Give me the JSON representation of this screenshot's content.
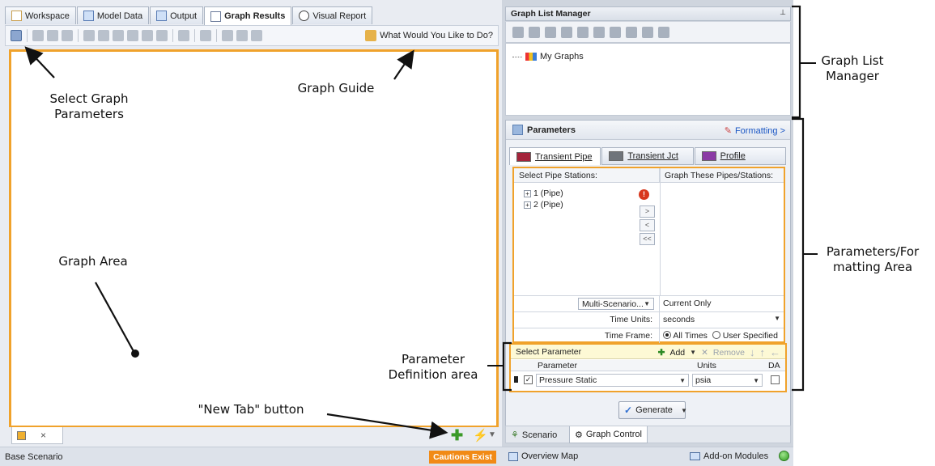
{
  "tabs": [
    {
      "label": "Workspace",
      "icon": "pencil-icon"
    },
    {
      "label": "Model Data",
      "icon": "table-icon"
    },
    {
      "label": "Output",
      "icon": "grid-icon"
    },
    {
      "label": "Graph Results",
      "icon": "graph-icon",
      "active": true
    },
    {
      "label": "Visual Report",
      "icon": "eye-icon"
    }
  ],
  "toolbar": {
    "what_would_you_like": "What Would You Like to Do?"
  },
  "bottom": {
    "close_glyph": "×"
  },
  "status_left": {
    "scenario": "Base Scenario",
    "cautions": "Cautions Exist"
  },
  "graph_list_manager": {
    "title": "Graph List Manager",
    "pin": "⊥",
    "root_item": "My Graphs"
  },
  "parameters": {
    "title": "Parameters",
    "formatting_link": "Formatting >",
    "tabs": [
      "Transient Pipe",
      "Transient Jct",
      "Profile"
    ],
    "select_pipe_stations": "Select Pipe Stations:",
    "graph_these": "Graph These Pipes/Stations:",
    "pipes": [
      "1 (Pipe)",
      "2 (Pipe)"
    ],
    "move_buttons": [
      ">",
      "<",
      "<<"
    ],
    "multi_scenario": "Multi-Scenario...",
    "current_only": "Current Only",
    "time_units_label": "Time Units:",
    "time_units_value": "seconds",
    "time_frame_label": "Time Frame:",
    "time_frame_options": [
      "All Times",
      "User Specified"
    ],
    "select_parameter": "Select Parameter",
    "add": "Add",
    "remove": "Remove",
    "col_parameter": "Parameter",
    "col_units": "Units",
    "col_da": "DA",
    "row_parameter": "Pressure Static",
    "row_units": "psia",
    "generate": "Generate"
  },
  "right_tabs": [
    {
      "label": "Scenario",
      "icon": "scenario-icon"
    },
    {
      "label": "Graph Control",
      "icon": "gear-icon",
      "active": true
    }
  ],
  "status_right": {
    "overview_map": "Overview Map",
    "addon_modules": "Add-on Modules"
  },
  "annotations": {
    "select_graph_params": [
      "Select Graph",
      "Parameters"
    ],
    "graph_guide": "Graph Guide",
    "graph_area": "Graph Area",
    "new_tab": "\"New Tab\" button",
    "param_def": [
      "Parameter",
      "Definition area"
    ],
    "glm": [
      "Graph List",
      "Manager"
    ],
    "params_formatting": [
      "Parameters/For",
      "matting Area"
    ]
  }
}
